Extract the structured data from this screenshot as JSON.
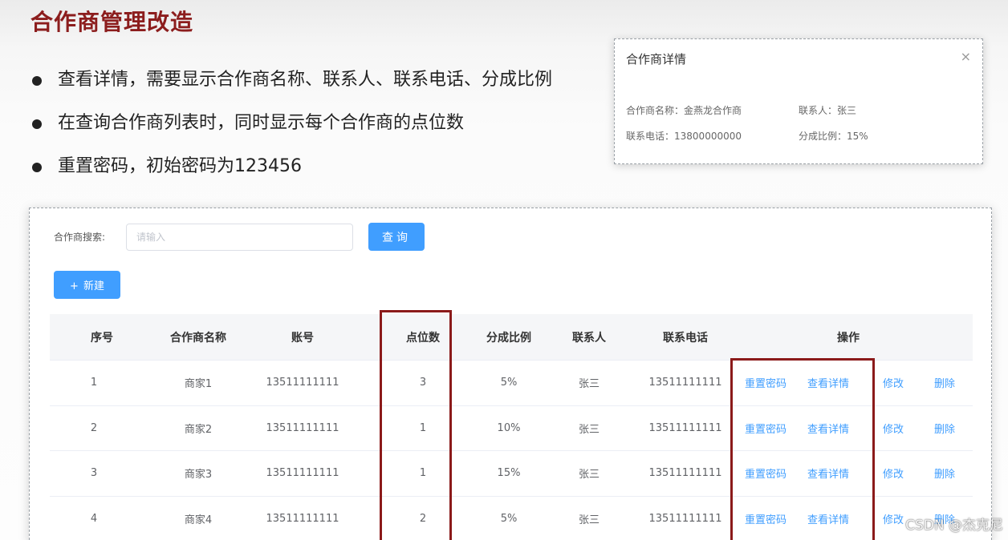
{
  "slide": {
    "title": "合作商管理改造",
    "bullets": [
      "查看详情，需要显示合作商名称、联系人、联系电话、分成比例",
      "在查询合作商列表时，同时显示每个合作商的点位数",
      "重置密码，初始密码为123456"
    ]
  },
  "dialog": {
    "title": "合作商详情",
    "close_glyph": "×",
    "name_label": "合作商名称：",
    "name_value": "金燕龙合作商",
    "contact_label": "联系人：",
    "contact_value": "张三",
    "phone_label": "联系电话：",
    "phone_value": "13800000000",
    "ratio_label": "分成比例：",
    "ratio_value": "15%"
  },
  "search": {
    "label": "合作商搜索:",
    "placeholder": "请输入",
    "value": "",
    "query_button": "查询"
  },
  "toolbar": {
    "new_icon": "+",
    "new_label": "新建"
  },
  "table": {
    "headers": {
      "index": "序号",
      "name": "合作商名称",
      "account": "账号",
      "points": "点位数",
      "ratio": "分成比例",
      "contact": "联系人",
      "phone": "联系电话",
      "actions": "操作"
    },
    "rows": [
      {
        "index": "1",
        "name": "商家1",
        "account": "13511111111",
        "points": "3",
        "ratio": "5%",
        "contact": "张三",
        "phone": "13511111111"
      },
      {
        "index": "2",
        "name": "商家2",
        "account": "13511111111",
        "points": "1",
        "ratio": "10%",
        "contact": "张三",
        "phone": "13511111111"
      },
      {
        "index": "3",
        "name": "商家3",
        "account": "13511111111",
        "points": "1",
        "ratio": "15%",
        "contact": "张三",
        "phone": "13511111111"
      },
      {
        "index": "4",
        "name": "商家4",
        "account": "13511111111",
        "points": "2",
        "ratio": "5%",
        "contact": "张三",
        "phone": "13511111111"
      }
    ],
    "actions": {
      "reset_password": "重置密码",
      "view_detail": "查看详情",
      "edit": "修改",
      "delete": "删除"
    }
  },
  "watermark": "CSDN @杰克尼",
  "colors": {
    "title": "#8c1d1d",
    "primary": "#409eff",
    "highlight": "#8b1a1a"
  }
}
